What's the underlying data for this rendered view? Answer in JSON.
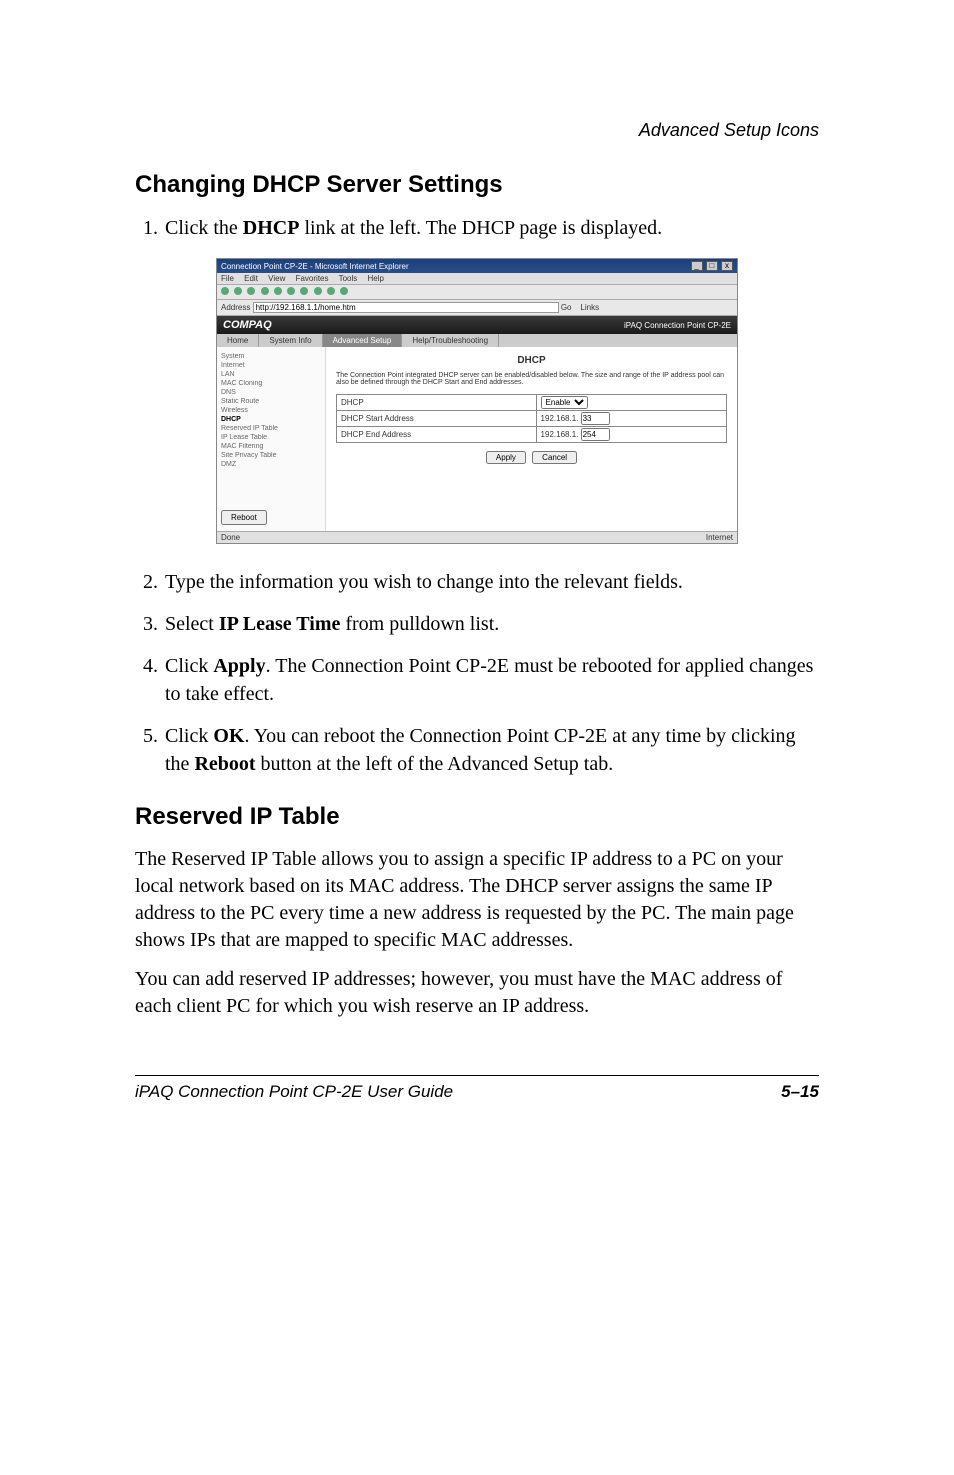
{
  "header": {
    "section_label": "Advanced Setup Icons"
  },
  "h1": {
    "title": "Changing DHCP Server Settings"
  },
  "steps1": {
    "s1_a": "Click the ",
    "s1_b": "DHCP",
    "s1_c": " link at the left. The DHCP page is displayed."
  },
  "screenshot": {
    "titlebar": "Connection Point CP-2E - Microsoft Internet Explorer",
    "menu": {
      "file": "File",
      "edit": "Edit",
      "view": "View",
      "favorites": "Favorites",
      "tools": "Tools",
      "help": "Help"
    },
    "addr_label": "Address",
    "addr_value": "http://192.168.1.1/home.htm",
    "go": "Go",
    "links": "Links",
    "brand": "COMPAQ",
    "brand_right": "iPAQ Connection Point CP-2E",
    "tabs": {
      "home": "Home",
      "sysinfo": "System Info",
      "advanced": "Advanced Setup",
      "trouble": "Help/Troubleshooting"
    },
    "side": {
      "i0": "System",
      "i1": "Internet",
      "i2": "LAN",
      "i3": "MAC Cloning",
      "i4": "DNS",
      "i5": "Static Route",
      "i6": "Wireless",
      "dhcp": "DHCP",
      "i7": "Reserved IP Table",
      "i8": "IP Lease Table",
      "i9": "MAC Filtering",
      "i10": "Site Privacy Table",
      "i11": "DMZ",
      "reboot": "Reboot"
    },
    "pane": {
      "title": "DHCP",
      "desc": "The Connection Point integrated DHCP server can be enabled/disabled below. The size and range of the IP address pool can also be defined through the DHCP Start and End addresses.",
      "row1": "DHCP",
      "row1_sel": "Enable",
      "row2": "DHCP Start Address",
      "row2_prefix": "192.168.1.",
      "row2_val": "33",
      "row3": "DHCP End Address",
      "row3_prefix": "192.168.1.",
      "row3_val": "254",
      "apply": "Apply",
      "cancel": "Cancel"
    },
    "status_left": "Done",
    "status_right": "Internet"
  },
  "steps2": {
    "s2": "Type the information you wish to change into the relevant fields.",
    "s3_a": "Select ",
    "s3_b": "IP Lease Time",
    "s3_c": " from pulldown list.",
    "s4_a": "Click ",
    "s4_b": "Apply",
    "s4_c": ". The Connection Point CP-2E must be rebooted for applied changes to take effect.",
    "s5_a": "Click ",
    "s5_b": "OK",
    "s5_c": ". You can reboot the Connection Point CP-2E at any time by clicking the ",
    "s5_d": "Reboot",
    "s5_e": " button at the left of the Advanced Setup tab."
  },
  "h2": {
    "title": "Reserved IP Table"
  },
  "para1": "The Reserved IP Table allows you to assign a specific IP address to a PC on your local network based on its MAC address. The DHCP server assigns the same IP address to the PC every time a new address is requested by the PC. The main page shows IPs that are mapped to specific MAC addresses.",
  "para2": "You can add reserved IP addresses; however, you must have the MAC address of each client PC for which you wish reserve an IP address.",
  "footer": {
    "left": "iPAQ Connection Point CP-2E User Guide",
    "right": "5–15"
  }
}
